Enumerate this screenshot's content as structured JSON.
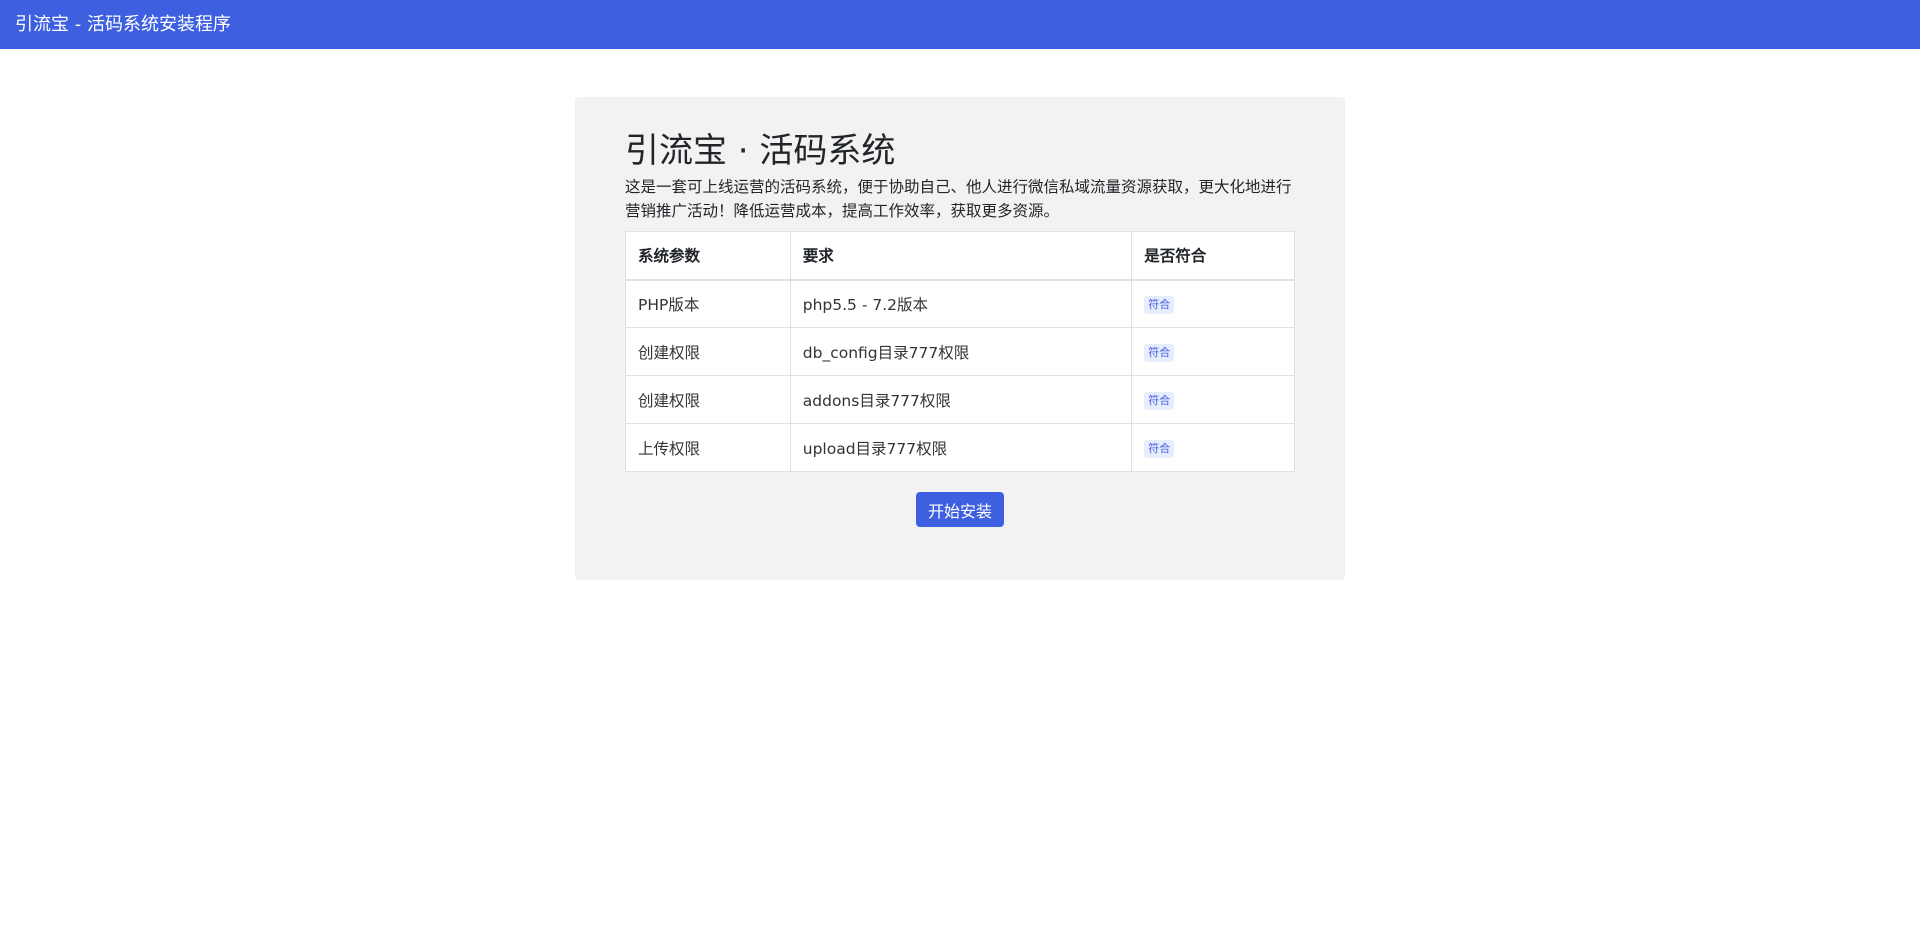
{
  "header": {
    "title": "引流宝 - 活码系统安装程序"
  },
  "card": {
    "title": "引流宝 · 活码系统",
    "description": "这是一套可上线运营的活码系统，便于协助自己、他人进行微信私域流量资源获取，更大化地进行营销推广活动！降低运营成本，提高工作效率，获取更多资源。"
  },
  "table": {
    "headers": [
      "系统参数",
      "要求",
      "是否符合"
    ],
    "rows": [
      {
        "param": "PHP版本",
        "requirement": "php5.5 - 7.2版本",
        "status": "符合"
      },
      {
        "param": "创建权限",
        "requirement": "db_config目录777权限",
        "status": "符合"
      },
      {
        "param": "创建权限",
        "requirement": "addons目录777权限",
        "status": "符合"
      },
      {
        "param": "上传权限",
        "requirement": "upload目录777权限",
        "status": "符合"
      }
    ]
  },
  "actions": {
    "install_label": "开始安装"
  },
  "colors": {
    "primary": "#3d5fe0",
    "card_background": "#f2f2f2"
  }
}
